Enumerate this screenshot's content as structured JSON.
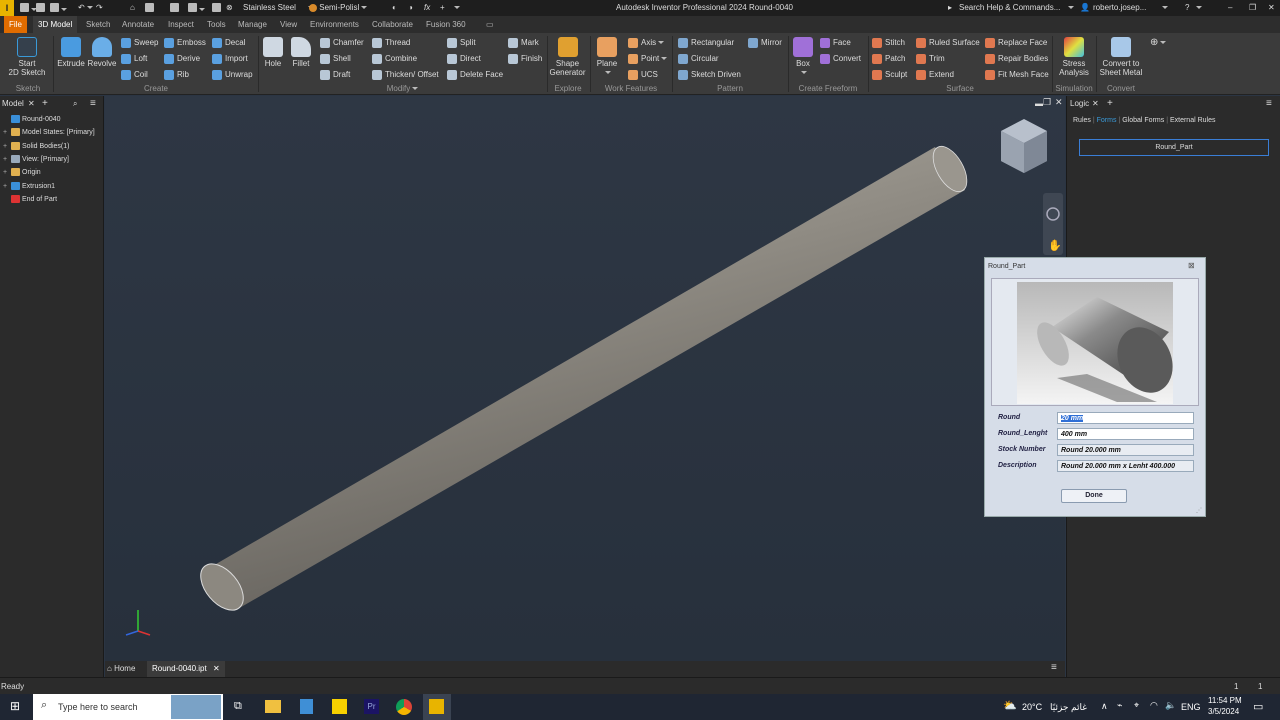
{
  "titlebar": {
    "app_initial": "I",
    "material": "Stainless Steel",
    "appearance": "Semi-Polisl",
    "window_title": "Autodesk Inventor Professional 2024   Round-0040",
    "search": "Search Help & Commands...",
    "user": "roberto.josep..."
  },
  "tabs": [
    "File",
    "3D Model",
    "Sketch",
    "Annotate",
    "Inspect",
    "Tools",
    "Manage",
    "View",
    "Environments",
    "Collaborate",
    "Fusion 360"
  ],
  "ribbon": {
    "groups": {
      "sketch": "Sketch",
      "create": "Create",
      "modify": "Modify",
      "explore": "Explore",
      "work_features": "Work Features",
      "pattern": "Pattern",
      "create_freeform": "Create Freeform",
      "surface": "Surface",
      "simulation": "Simulation",
      "convert": "Convert"
    },
    "start_sketch": [
      "Start",
      "2D Sketch"
    ],
    "extrude": "Extrude",
    "revolve": "Revolve",
    "sweep": "Sweep",
    "loft": "Loft",
    "coil": "Coil",
    "emboss": "Emboss",
    "derive": "Derive",
    "rib": "Rib",
    "decal": "Decal",
    "import": "Import",
    "unwrap": "Unwrap",
    "hole": "Hole",
    "fillet": "Fillet",
    "chamfer": "Chamfer",
    "shell": "Shell",
    "draft": "Draft",
    "thread": "Thread",
    "combine": "Combine",
    "thicken": "Thicken/ Offset",
    "split": "Split",
    "direct": "Direct",
    "delete_face": "Delete Face",
    "mark": "Mark",
    "finish": "Finish",
    "shape_generator": [
      "Shape",
      "Generator"
    ],
    "plane": "Plane",
    "axis": "Axis",
    "point": "Point",
    "ucs": "UCS",
    "rectangular": "Rectangular",
    "circular": "Circular",
    "sketch_driven": "Sketch Driven",
    "mirror": "Mirror",
    "box": "Box",
    "face": "Face",
    "convert_ff": "Convert",
    "stitch": "Stitch",
    "patch": "Patch",
    "sculpt": "Sculpt",
    "ruled_surface": "Ruled Surface",
    "trim": "Trim",
    "extend": "Extend",
    "replace_face": "Replace Face",
    "repair_bodies": "Repair Bodies",
    "fit_mesh_face": "Fit Mesh Face",
    "stress_analysis": [
      "Stress",
      "Analysis"
    ],
    "convert_sheet": [
      "Convert to",
      "Sheet Metal"
    ]
  },
  "model_panel": {
    "tab": "Model",
    "tree": [
      {
        "label": "Round-0040",
        "expand": ""
      },
      {
        "label": "Model States: [Primary]",
        "expand": "+"
      },
      {
        "label": "Solid Bodies(1)",
        "expand": "+"
      },
      {
        "label": "View: [Primary]",
        "expand": "+"
      },
      {
        "label": "Origin",
        "expand": "+"
      },
      {
        "label": "Extrusion1",
        "expand": "+"
      },
      {
        "label": "End of Part",
        "expand": ""
      }
    ]
  },
  "logic_panel": {
    "tab": "Logic",
    "sub_tabs": [
      "Rules",
      "Forms",
      "Global Forms",
      "External Rules"
    ],
    "form_item": "Round_Part"
  },
  "dialog": {
    "title": "Round_Part",
    "fields": [
      {
        "label": "Round",
        "value": "20 mm"
      },
      {
        "label": "Round_Lenght",
        "value": "400 mm"
      },
      {
        "label": "Stock Number",
        "value": "Round 20.000 mm"
      },
      {
        "label": "Description",
        "value": "Round 20.000 mm x Lenht 400.000"
      }
    ],
    "done": "Done"
  },
  "view_tabs": {
    "home": "Home",
    "doc": "Round-0040.ipt"
  },
  "status": {
    "text": "Ready",
    "counts": [
      "1",
      "1"
    ]
  },
  "taskbar": {
    "search_placeholder": "Type here to search",
    "weather": "20°C",
    "weather_text": "غائم جزئيًا",
    "lang": "ENG",
    "time": "11:54 PM",
    "date": "3/5/2024"
  },
  "colors": {
    "file_tab": "#e06c00",
    "ribbon_bg": "#3b3b3b",
    "viewport": "#2b3543",
    "selection": "#2f6fd6"
  }
}
